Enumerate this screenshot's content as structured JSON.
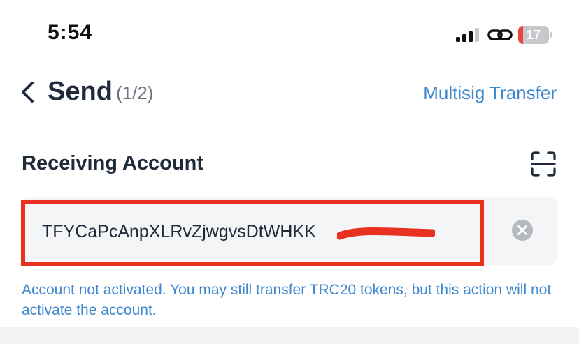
{
  "status_bar": {
    "time": "5:54",
    "battery_level": "17",
    "battery_fraction": 0.17,
    "icons": [
      "signal-icon",
      "link-icon",
      "battery-icon"
    ]
  },
  "nav": {
    "title": "Send",
    "step": "(1/2)",
    "action_link": "Multisig Transfer",
    "back_icon": "chevron-left-icon"
  },
  "receiving": {
    "label": "Receiving Account",
    "scan_icon": "scan-icon",
    "address_value": "TFYCaPcAnpXLRvZjwgvsDtWHKK",
    "clear_icon": "clear-circle-icon",
    "warning": "Account not activated. You may still transfer TRC20 tokens, but this action will not activate the account."
  },
  "colors": {
    "accent": "#3f87cf",
    "title_text": "#1f2a3a",
    "highlight": "#e8321f",
    "input_bg": "#f4f5f7"
  }
}
